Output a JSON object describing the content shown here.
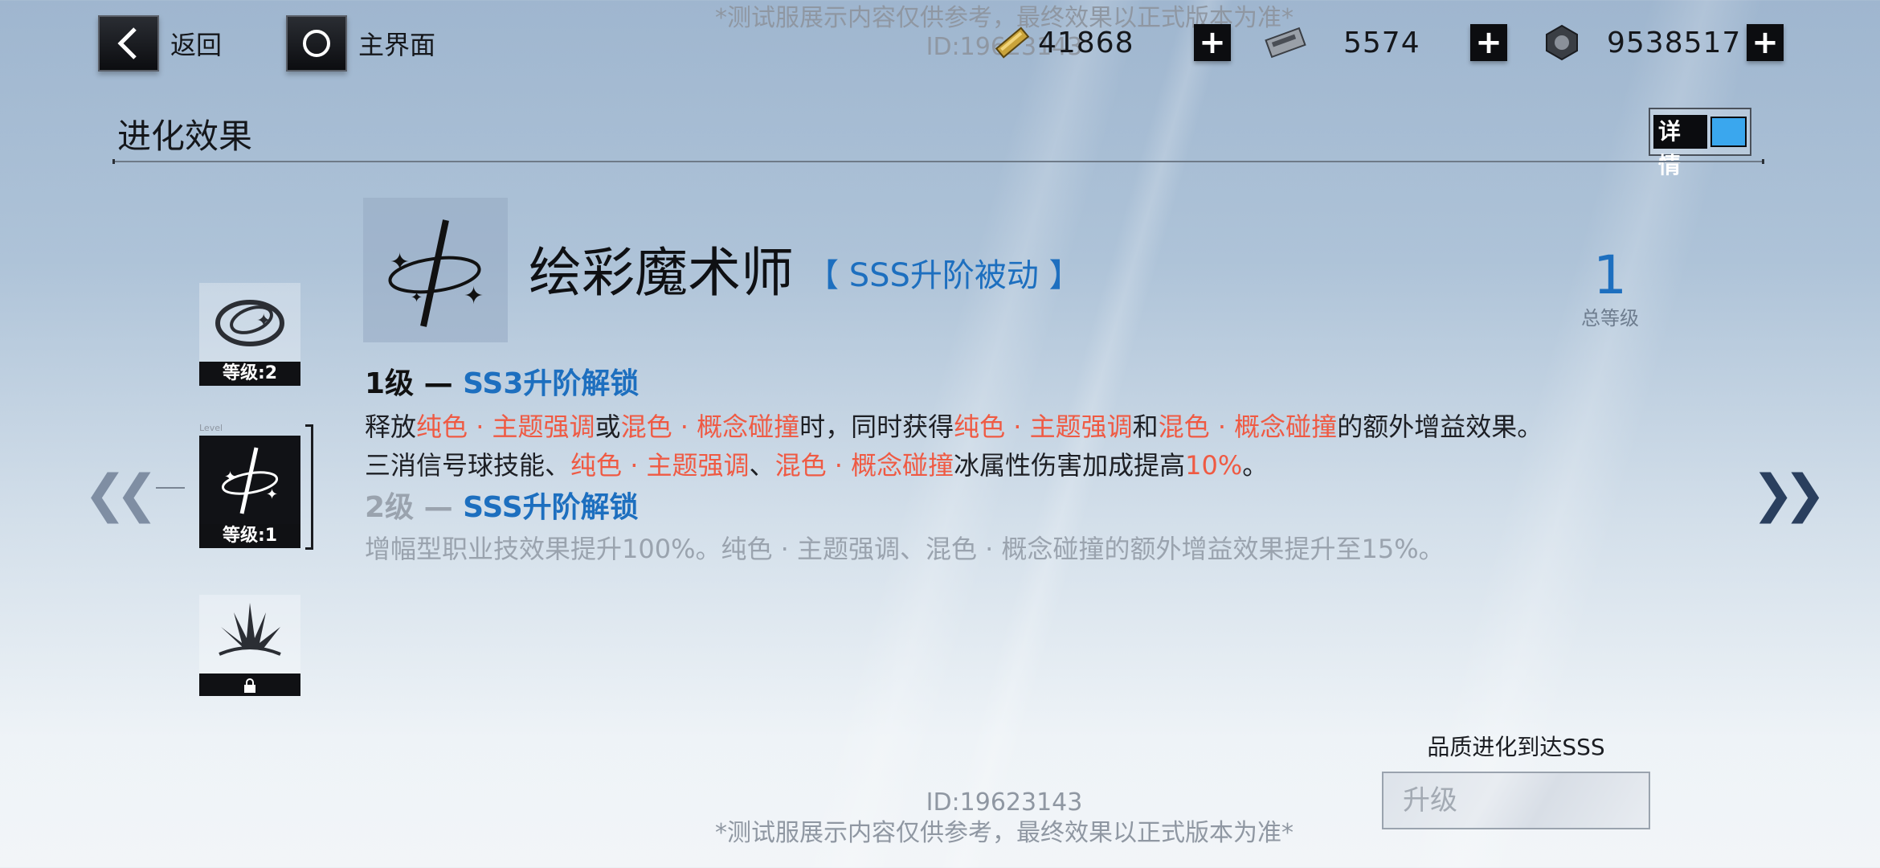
{
  "nav": {
    "back_label": "返回",
    "home_label": "主界面"
  },
  "watermark": {
    "id_text": "ID:19623143",
    "notice": "*测试服展示内容仅供参考，最终效果以正式版本为准*"
  },
  "resources": [
    {
      "icon": "gold-bar-icon",
      "value": "41868"
    },
    {
      "icon": "chip-card-icon",
      "value": "5574"
    },
    {
      "icon": "hex-nut-icon",
      "value": "9538517"
    }
  ],
  "header": {
    "title": "进化效果",
    "detail_label": "详情"
  },
  "levels": [
    {
      "label": "等级:2"
    },
    {
      "label": "等级:1",
      "small": "Level"
    },
    {
      "label": "",
      "locked": true
    }
  ],
  "skill": {
    "name": "绘彩魔术师",
    "tag": "【 SSS升阶被动 】",
    "total_level": "1",
    "total_level_label": "总等级"
  },
  "level1": {
    "num": "1级 — ",
    "unlock": "SS3升阶解锁",
    "line1": [
      "释放",
      "纯色 · 主题强调",
      "或",
      "混色 · 概念碰撞",
      "时，同时获得",
      "纯色 · 主题强调",
      "和",
      "混色 · 概念碰撞",
      "的额外增益效果。"
    ],
    "line2": [
      "三消信号球技能、",
      "纯色 · 主题强调",
      "、",
      "混色 · 概念碰撞",
      "冰属性伤害加成提高",
      "10%",
      "。"
    ]
  },
  "level2": {
    "num": "2级 — ",
    "unlock": "SSS升阶解锁",
    "line": "增幅型职业技效果提升100%。纯色 · 主题强调、混色 · 概念碰撞的额外增益效果提升至15%。"
  },
  "bottom": {
    "requirement": "品质进化到达SSS",
    "upgrade_label": "升级"
  },
  "colors": {
    "accent_blue": "#1d6fbf",
    "highlight_red": "#ef5a43",
    "toggle_blue": "#3aa7ee"
  }
}
